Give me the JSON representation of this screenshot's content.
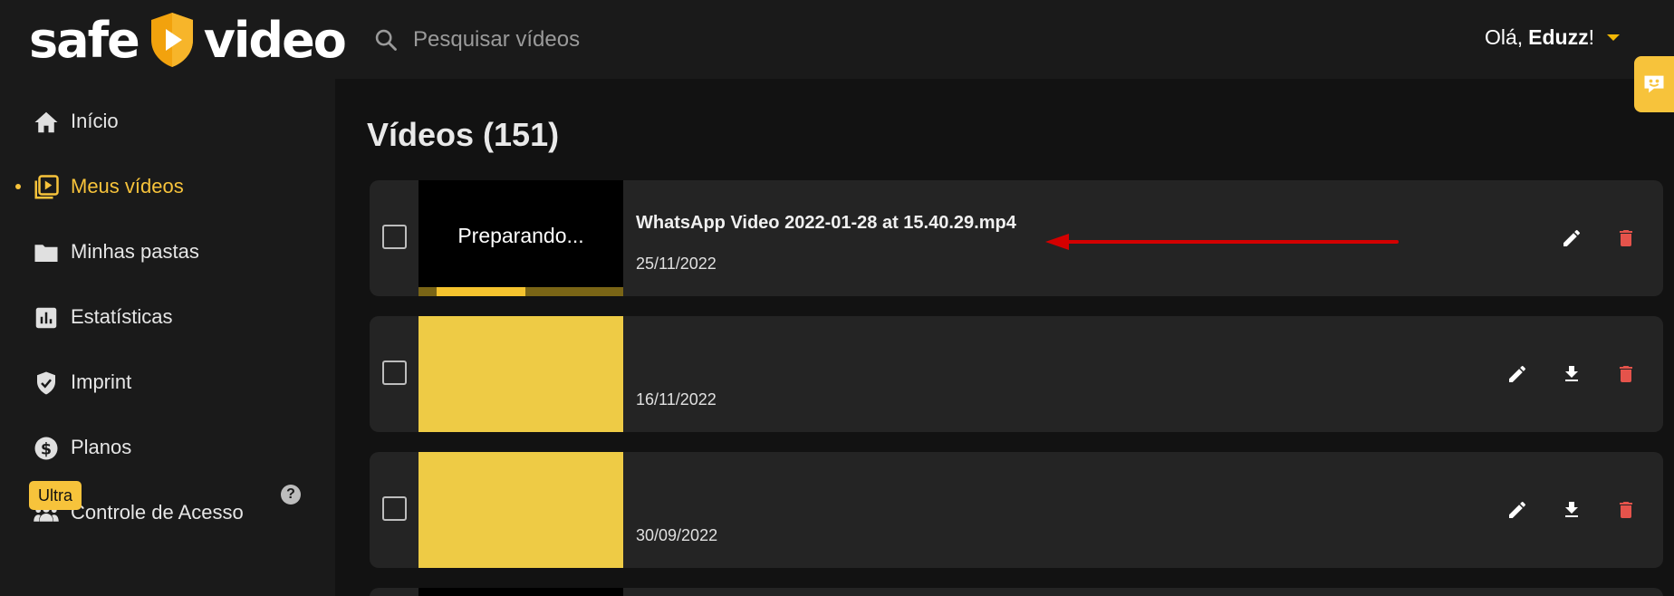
{
  "header": {
    "logo_left": "safe",
    "logo_right": "video",
    "search_placeholder": "Pesquisar vídeos",
    "greeting": "Olá,",
    "user_name": "Eduzz",
    "greeting_suffix": "!"
  },
  "sidebar": {
    "items": [
      {
        "label": "Início",
        "icon": "home-icon"
      },
      {
        "label": "Meus vídeos",
        "icon": "video-library-icon",
        "active": true
      },
      {
        "label": "Minhas pastas",
        "icon": "folder-icon"
      },
      {
        "label": "Estatísticas",
        "icon": "bar-chart-icon"
      },
      {
        "label": "Imprint",
        "icon": "shield-check-icon"
      },
      {
        "label": "Planos",
        "icon": "dollar-circle-icon"
      },
      {
        "label": "Controle de Acesso",
        "icon": "group-icon"
      }
    ],
    "plan_badge": "Ultra",
    "help": "?"
  },
  "main": {
    "title": "Vídeos (151)",
    "videos": [
      {
        "title": "WhatsApp Video 2022-01-28 at 15.40.29.mp4",
        "date": "25/11/2022",
        "status": "Preparando...",
        "progress": 0.52,
        "thumb": "dark",
        "actions": [
          "edit",
          "delete"
        ]
      },
      {
        "title": "",
        "date": "16/11/2022",
        "thumb": "yellow",
        "actions": [
          "edit",
          "download",
          "delete"
        ]
      },
      {
        "title": "",
        "date": "30/09/2022",
        "thumb": "yellow",
        "actions": [
          "edit",
          "download",
          "delete"
        ]
      }
    ]
  },
  "colors": {
    "accent": "#f7c33b",
    "delete": "#e5534b",
    "annotation_arrow": "#d40000"
  }
}
